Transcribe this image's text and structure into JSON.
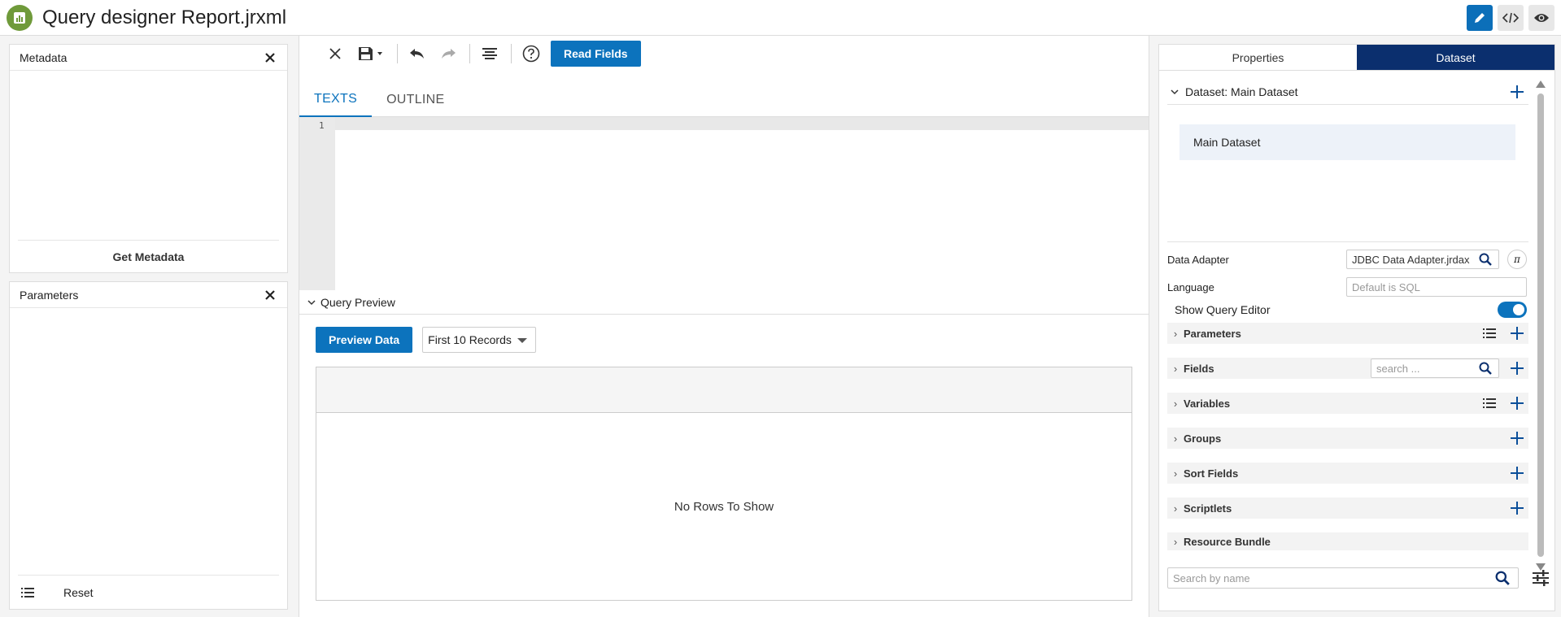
{
  "header": {
    "title": "Query designer Report.jrxml",
    "logo_icon": "report-chart-icon",
    "buttons": [
      "edit-icon",
      "code-icon",
      "preview-eye-icon"
    ],
    "accent": "#0c73bd"
  },
  "metadata_panel": {
    "title": "Metadata",
    "action": "Get Metadata"
  },
  "parameters_panel": {
    "title": "Parameters",
    "reset": "Reset"
  },
  "toolbar": {
    "read_fields": "Read Fields"
  },
  "editor": {
    "tabs": [
      "TEXTS",
      "OUTLINE"
    ],
    "line_number": "1"
  },
  "query_preview": {
    "title": "Query Preview",
    "preview_button": "Preview Data",
    "records_select": "First 10 Records",
    "empty_message": "No Rows To Show"
  },
  "right_panel": {
    "tabs": [
      "Properties",
      "Dataset"
    ],
    "active_tab": "Dataset",
    "dataset_header": "Dataset: Main Dataset",
    "dataset_item": "Main Dataset",
    "data_adapter_label": "Data Adapter",
    "data_adapter_value": "JDBC Data Adapter.jrdax",
    "language_label": "Language",
    "language_placeholder": "Default is SQL",
    "show_query_editor_label": "Show Query Editor",
    "show_query_editor_on": true,
    "fields_search_placeholder": "search ...",
    "sections": [
      "Parameters",
      "Fields",
      "Variables",
      "Groups",
      "Sort Fields",
      "Scriptlets",
      "Resource Bundle"
    ],
    "search_placeholder": "Search by name",
    "brand_dark": "#0b2f6e"
  }
}
